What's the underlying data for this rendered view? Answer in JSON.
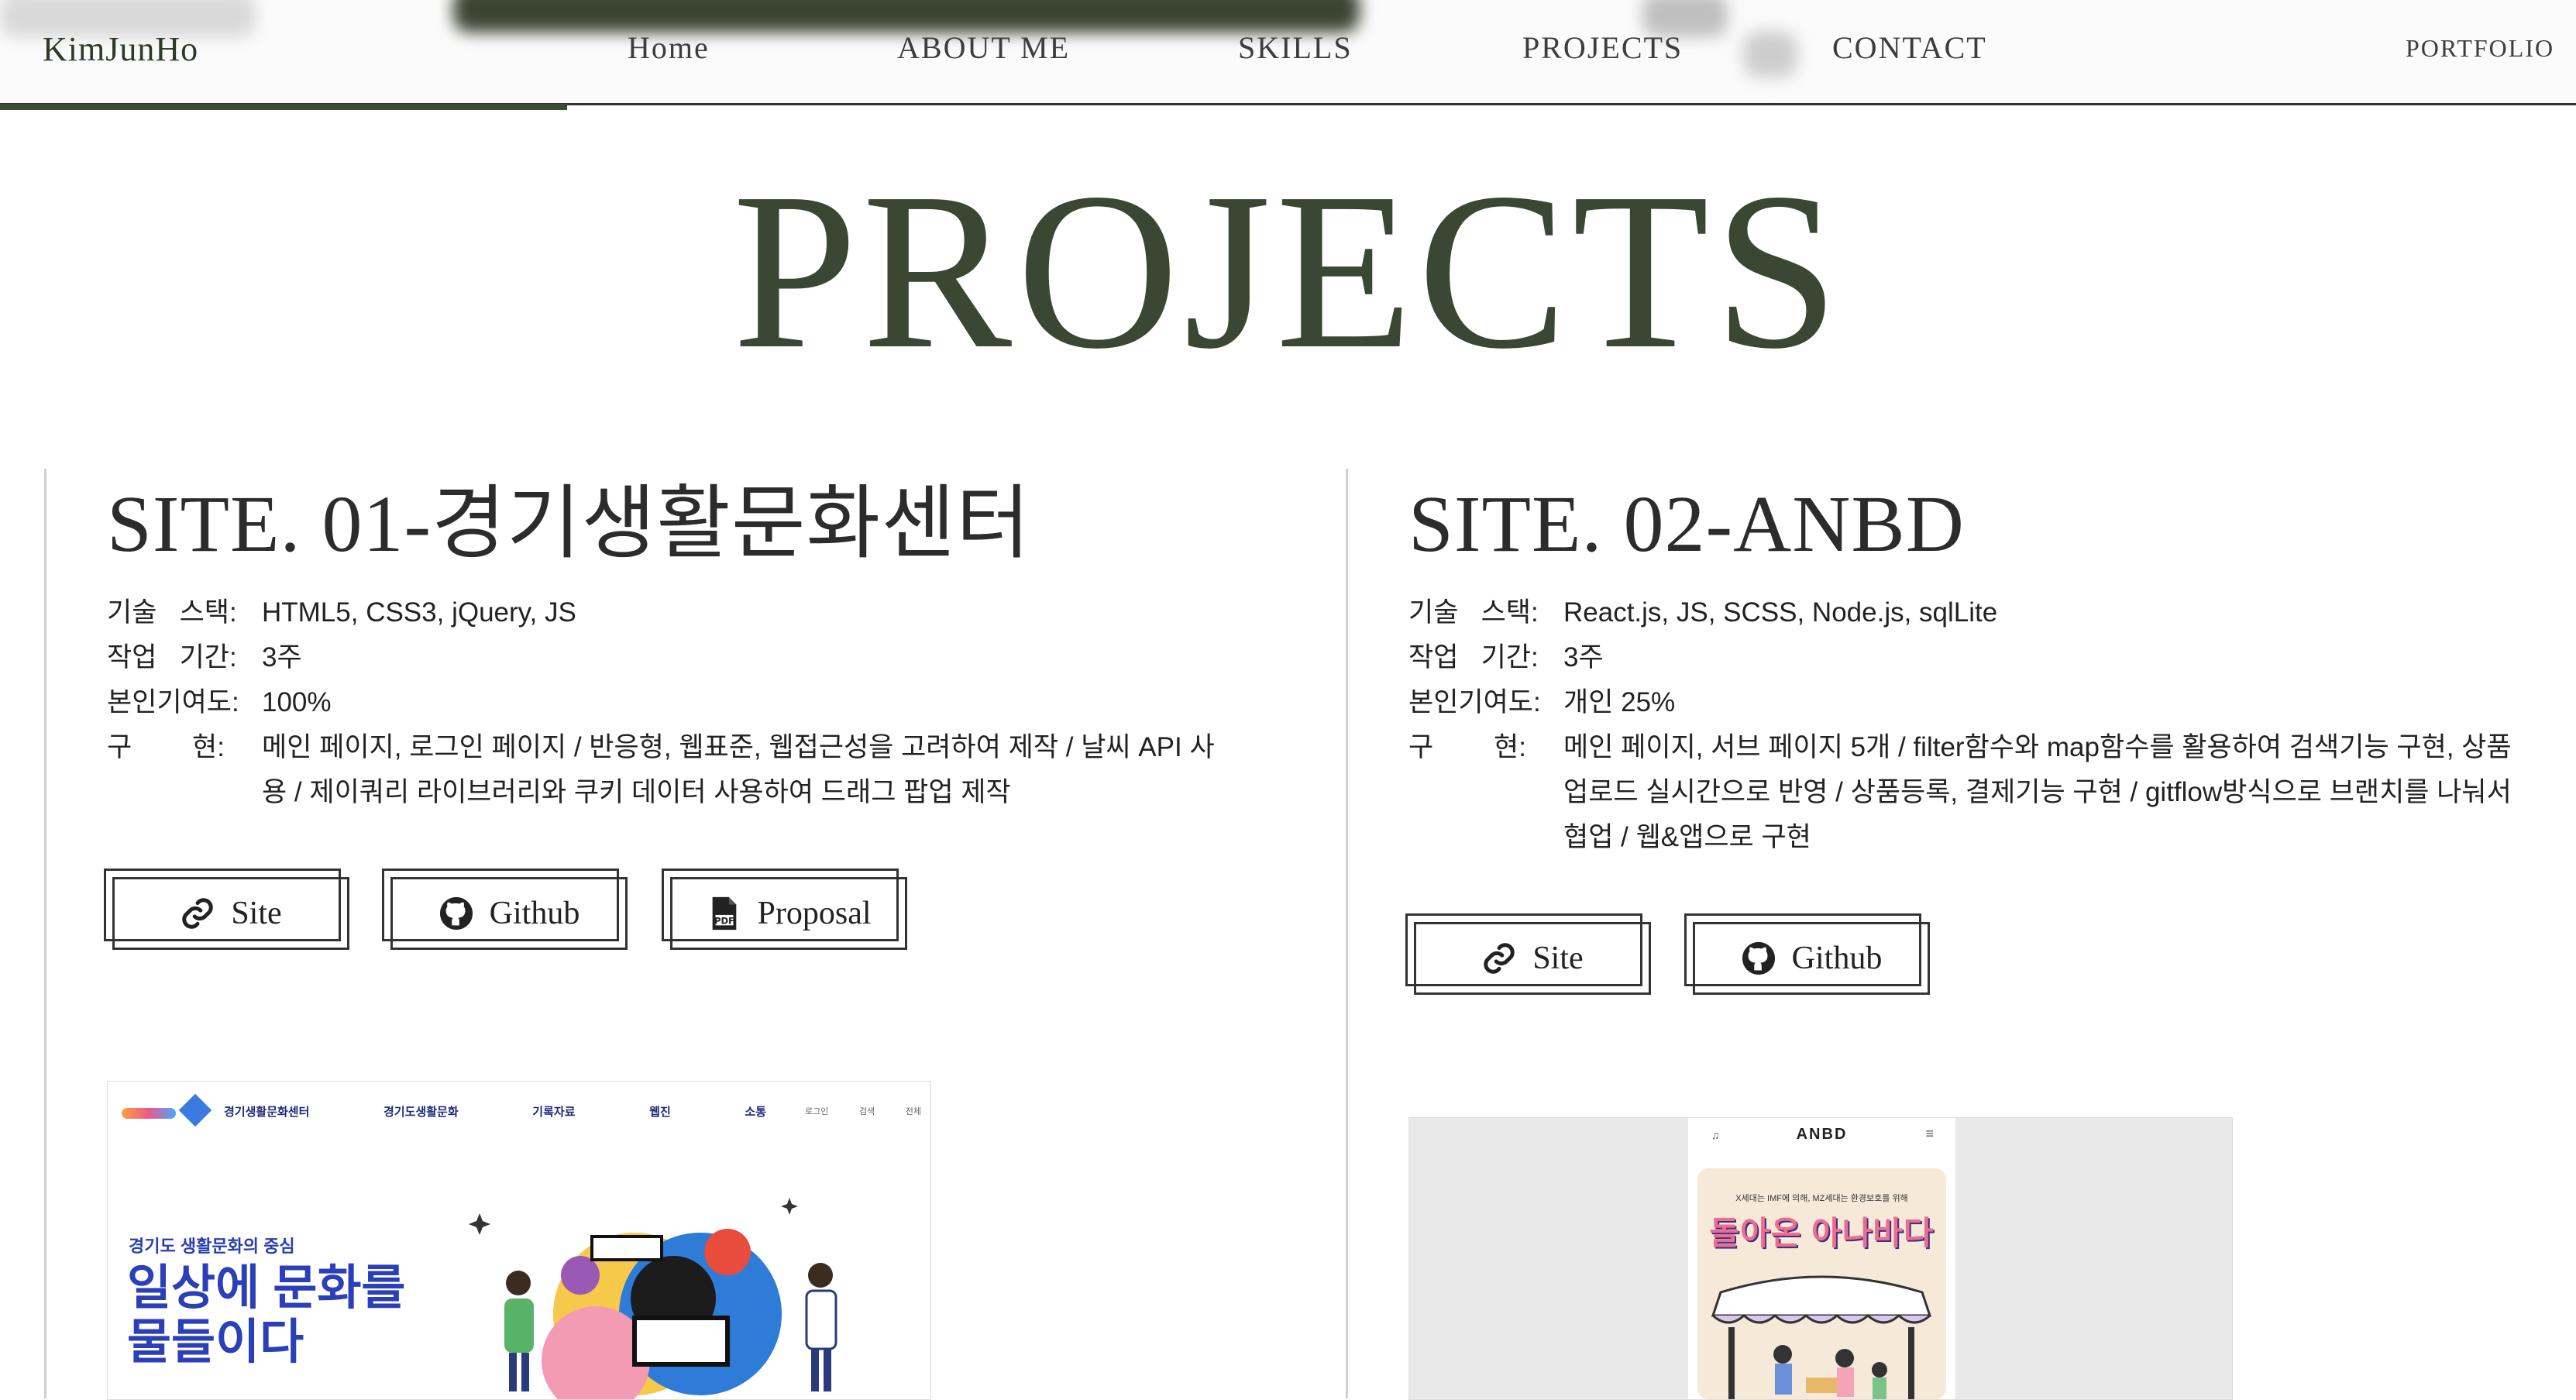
{
  "header": {
    "brand": "KimJunHo",
    "nav": [
      "Home",
      "ABOUT ME",
      "SKILLS",
      "PROJECTS",
      "CONTACT"
    ],
    "right_label": "PORTFOLIO",
    "scroll_progress": 0.22
  },
  "section": {
    "title": "PROJECTS"
  },
  "projects": [
    {
      "title": "SITE. 01-경기생활문화센터",
      "rows": [
        {
          "label": "기술   스택:",
          "value": "HTML5, CSS3, jQuery, JS"
        },
        {
          "label": "작업   기간:",
          "value": "3주"
        },
        {
          "label": "본인기여도:",
          "value": "100%"
        },
        {
          "label": "구        현:",
          "value": "메인 페이지, 로그인 페이지 / 반응형, 웹표준, 웹접근성을 고려하여 제작 / 날씨 API 사용 / 제이쿼리 라이브러리와 쿠키 데이터 사용하여 드래그 팝업 제작"
        }
      ],
      "buttons": [
        "Site",
        "Github",
        "Proposal"
      ],
      "preview": {
        "menu": [
          "경기생활문화센터",
          "경기도생활문화",
          "기록자료",
          "웹진",
          "소통"
        ],
        "subtitle": "경기도 생활문화의 중심",
        "headline_1": "일상에 문화를",
        "headline_2": "물들이다",
        "util": [
          "로그인",
          "검색",
          "전체"
        ]
      }
    },
    {
      "title": "SITE. 02-ANBD",
      "rows": [
        {
          "label": "기술   스택:",
          "value": "React.js, JS, SCSS, Node.js, sqlLite"
        },
        {
          "label": "작업   기간:",
          "value": "3주"
        },
        {
          "label": "본인기여도:",
          "value": "개인 25%"
        },
        {
          "label": "구        현:",
          "value": "메인 페이지, 서브 페이지 5개 / filter함수와 map함수를 활용하여 검색기능 구현, 상품업로드 실시간으로 반영 / 상품등록, 결제기능 구현 / gitflow방식으로 브랜치를 나눠서 협업 / 웹&앱으로 구현"
        }
      ],
      "buttons": [
        "Site",
        "Github"
      ],
      "preview": {
        "logo": "ANBD",
        "tagline": "X세대는 IMF에 의해, MZ세대는 환경보호를 위해",
        "banner": "돌아온 아나바다"
      }
    }
  ],
  "colors": {
    "accent": "#3a4733",
    "line": "#333333"
  }
}
